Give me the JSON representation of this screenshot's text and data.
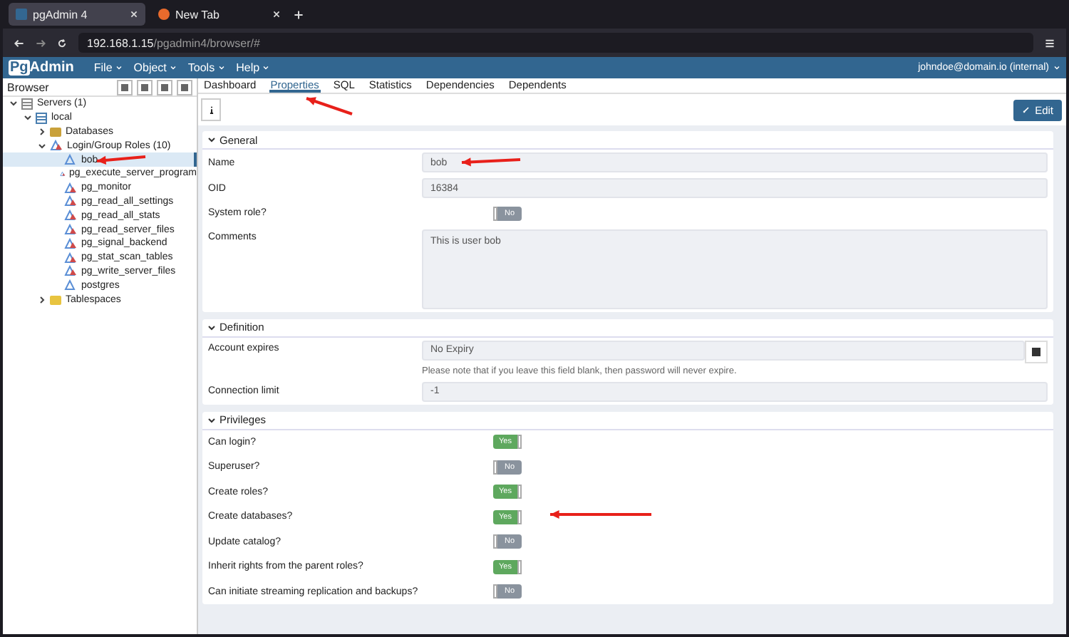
{
  "browser_tabs": [
    {
      "title": "pgAdmin 4",
      "selected": true
    },
    {
      "title": "New Tab",
      "selected": false
    }
  ],
  "address_bar": {
    "host": "192.168.1.15",
    "path": "/pgadmin4/browser/#"
  },
  "app_header": {
    "logo_a": "Pg",
    "logo_b": "Admin",
    "menus": [
      "File",
      "Object",
      "Tools",
      "Help"
    ],
    "user": "johndoe@domain.io (internal)"
  },
  "sidebar": {
    "title": "Browser",
    "tree": [
      {
        "label": "Servers (1)",
        "kind": "servers",
        "expanded": true,
        "selected": false,
        "children": [
          {
            "label": "local",
            "kind": "server",
            "expanded": true,
            "selected": false,
            "children": [
              {
                "label": "Databases",
                "kind": "databases",
                "expanded": false,
                "selected": false
              },
              {
                "label": "Login/Group Roles (10)",
                "kind": "roles",
                "expanded": true,
                "selected": false,
                "children": [
                  {
                    "label": "bob",
                    "kind": "login",
                    "selected": true
                  },
                  {
                    "label": "pg_execute_server_program",
                    "kind": "group",
                    "selected": false
                  },
                  {
                    "label": "pg_monitor",
                    "kind": "group",
                    "selected": false
                  },
                  {
                    "label": "pg_read_all_settings",
                    "kind": "group",
                    "selected": false
                  },
                  {
                    "label": "pg_read_all_stats",
                    "kind": "group",
                    "selected": false
                  },
                  {
                    "label": "pg_read_server_files",
                    "kind": "group",
                    "selected": false
                  },
                  {
                    "label": "pg_signal_backend",
                    "kind": "group",
                    "selected": false
                  },
                  {
                    "label": "pg_stat_scan_tables",
                    "kind": "group",
                    "selected": false
                  },
                  {
                    "label": "pg_write_server_files",
                    "kind": "group",
                    "selected": false
                  },
                  {
                    "label": "postgres",
                    "kind": "login",
                    "selected": false
                  }
                ]
              },
              {
                "label": "Tablespaces",
                "kind": "tablespaces",
                "expanded": false,
                "selected": false
              }
            ]
          }
        ]
      }
    ]
  },
  "tabs": [
    {
      "label": "Dashboard",
      "selected": false
    },
    {
      "label": "Properties",
      "selected": true
    },
    {
      "label": "SQL",
      "selected": false
    },
    {
      "label": "Statistics",
      "selected": false
    },
    {
      "label": "Dependencies",
      "selected": false
    },
    {
      "label": "Dependents",
      "selected": false
    }
  ],
  "edit_button": "Edit",
  "sections": [
    {
      "title": "General",
      "expanded": true,
      "rows": [
        {
          "kind": "text",
          "label": "Name",
          "value": "bob"
        },
        {
          "kind": "text",
          "label": "OID",
          "value": "16384"
        },
        {
          "kind": "switch",
          "label": "System role?",
          "on": false,
          "value": "No"
        },
        {
          "kind": "textarea",
          "label": "Comments",
          "value": "This is user bob"
        }
      ]
    },
    {
      "title": "Definition",
      "expanded": true,
      "rows": [
        {
          "kind": "date",
          "label": "Account expires",
          "value": "No Expiry",
          "help": "Please note that if you leave this field blank, then password will never expire."
        },
        {
          "kind": "text",
          "label": "Connection limit",
          "value": "-1"
        }
      ]
    },
    {
      "title": "Privileges",
      "expanded": true,
      "rows": [
        {
          "kind": "switch",
          "label": "Can login?",
          "on": true,
          "value": "Yes"
        },
        {
          "kind": "switch",
          "label": "Superuser?",
          "on": false,
          "value": "No"
        },
        {
          "kind": "switch",
          "label": "Create roles?",
          "on": true,
          "value": "Yes"
        },
        {
          "kind": "switch",
          "label": "Create databases?",
          "on": true,
          "value": "Yes"
        },
        {
          "kind": "switch",
          "label": "Update catalog?",
          "on": false,
          "value": "No"
        },
        {
          "kind": "switch",
          "label": "Inherit rights from the parent roles?",
          "on": true,
          "value": "Yes"
        },
        {
          "kind": "switch",
          "label": "Can initiate streaming replication and backups?",
          "on": false,
          "value": "No"
        }
      ]
    }
  ]
}
